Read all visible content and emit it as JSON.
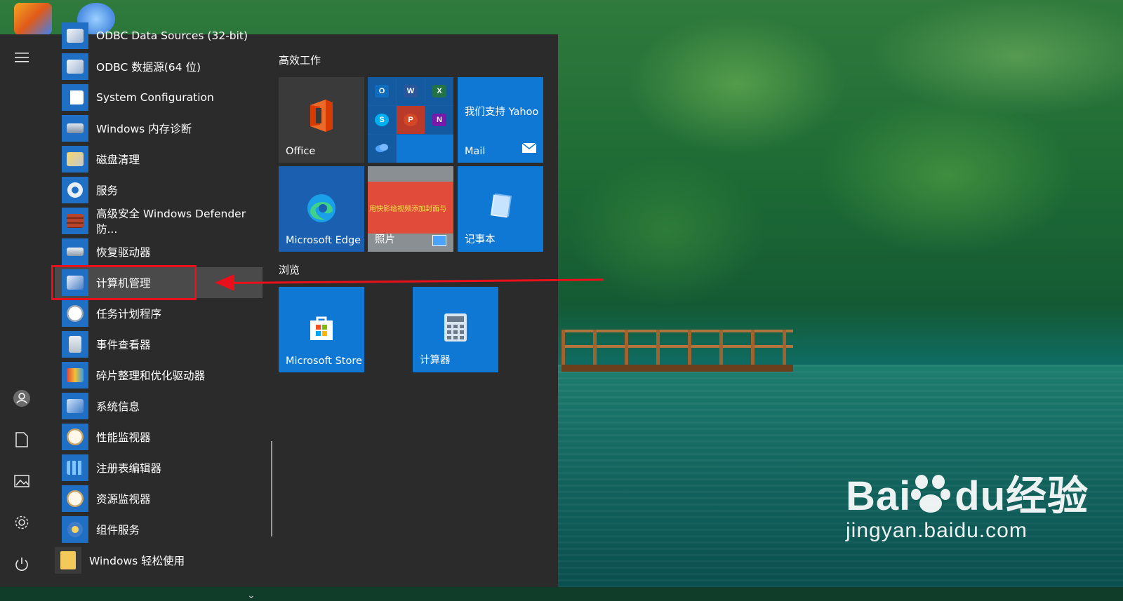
{
  "start_menu": {
    "apps": [
      {
        "label": "ODBC Data Sources (32-bit)"
      },
      {
        "label": "ODBC 数据源(64 位)"
      },
      {
        "label": "System Configuration"
      },
      {
        "label": "Windows 内存诊断"
      },
      {
        "label": "磁盘清理"
      },
      {
        "label": "服务"
      },
      {
        "label": "高级安全 Windows Defender 防..."
      },
      {
        "label": "恢复驱动器"
      },
      {
        "label": "计算机管理"
      },
      {
        "label": "任务计划程序"
      },
      {
        "label": "事件查看器"
      },
      {
        "label": "碎片整理和优化驱动器"
      },
      {
        "label": "系统信息"
      },
      {
        "label": "性能监视器"
      },
      {
        "label": "注册表编辑器"
      },
      {
        "label": "资源监视器"
      },
      {
        "label": "组件服务"
      }
    ],
    "folder": {
      "label": "Windows 轻松使用"
    },
    "groups": {
      "productivity": {
        "title": "高效工作",
        "office": "Office",
        "yahoo_text": "我们支持 Yahoo",
        "mail": "Mail",
        "edge": "Microsoft Edge",
        "photos": "照片",
        "photo_banner": "用快影给视频添加封面与",
        "notepad": "记事本"
      },
      "browse": {
        "title": "浏览",
        "store": "Microsoft Store",
        "calculator": "计算器"
      }
    }
  },
  "watermark": {
    "brand_a": "Bai",
    "brand_b": "du",
    "brand_cn": "经验",
    "url": "jingyan.baidu.com"
  },
  "colors": {
    "tile_blue": "#0f78d4",
    "annotation_red": "#e8111b",
    "menu_bg": "#2b2b2b"
  }
}
